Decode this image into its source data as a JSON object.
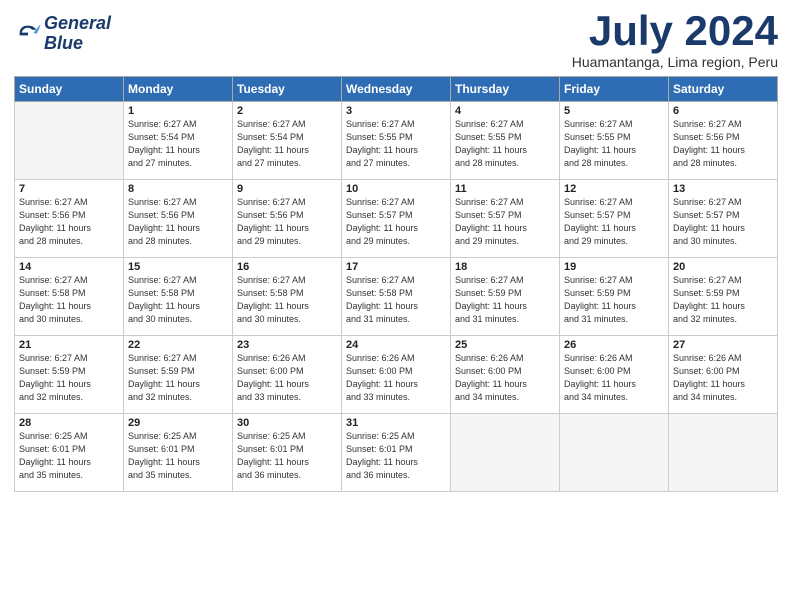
{
  "logo": {
    "line1": "General",
    "line2": "Blue"
  },
  "title": "July 2024",
  "subtitle": "Huamantanga, Lima region, Peru",
  "days_of_week": [
    "Sunday",
    "Monday",
    "Tuesday",
    "Wednesday",
    "Thursday",
    "Friday",
    "Saturday"
  ],
  "weeks": [
    [
      {
        "day": "",
        "details": ""
      },
      {
        "day": "1",
        "details": "Sunrise: 6:27 AM\nSunset: 5:54 PM\nDaylight: 11 hours\nand 27 minutes."
      },
      {
        "day": "2",
        "details": "Sunrise: 6:27 AM\nSunset: 5:54 PM\nDaylight: 11 hours\nand 27 minutes."
      },
      {
        "day": "3",
        "details": "Sunrise: 6:27 AM\nSunset: 5:55 PM\nDaylight: 11 hours\nand 27 minutes."
      },
      {
        "day": "4",
        "details": "Sunrise: 6:27 AM\nSunset: 5:55 PM\nDaylight: 11 hours\nand 28 minutes."
      },
      {
        "day": "5",
        "details": "Sunrise: 6:27 AM\nSunset: 5:55 PM\nDaylight: 11 hours\nand 28 minutes."
      },
      {
        "day": "6",
        "details": "Sunrise: 6:27 AM\nSunset: 5:56 PM\nDaylight: 11 hours\nand 28 minutes."
      }
    ],
    [
      {
        "day": "7",
        "details": "Sunrise: 6:27 AM\nSunset: 5:56 PM\nDaylight: 11 hours\nand 28 minutes."
      },
      {
        "day": "8",
        "details": "Sunrise: 6:27 AM\nSunset: 5:56 PM\nDaylight: 11 hours\nand 28 minutes."
      },
      {
        "day": "9",
        "details": "Sunrise: 6:27 AM\nSunset: 5:56 PM\nDaylight: 11 hours\nand 29 minutes."
      },
      {
        "day": "10",
        "details": "Sunrise: 6:27 AM\nSunset: 5:57 PM\nDaylight: 11 hours\nand 29 minutes."
      },
      {
        "day": "11",
        "details": "Sunrise: 6:27 AM\nSunset: 5:57 PM\nDaylight: 11 hours\nand 29 minutes."
      },
      {
        "day": "12",
        "details": "Sunrise: 6:27 AM\nSunset: 5:57 PM\nDaylight: 11 hours\nand 29 minutes."
      },
      {
        "day": "13",
        "details": "Sunrise: 6:27 AM\nSunset: 5:57 PM\nDaylight: 11 hours\nand 30 minutes."
      }
    ],
    [
      {
        "day": "14",
        "details": "Sunrise: 6:27 AM\nSunset: 5:58 PM\nDaylight: 11 hours\nand 30 minutes."
      },
      {
        "day": "15",
        "details": "Sunrise: 6:27 AM\nSunset: 5:58 PM\nDaylight: 11 hours\nand 30 minutes."
      },
      {
        "day": "16",
        "details": "Sunrise: 6:27 AM\nSunset: 5:58 PM\nDaylight: 11 hours\nand 30 minutes."
      },
      {
        "day": "17",
        "details": "Sunrise: 6:27 AM\nSunset: 5:58 PM\nDaylight: 11 hours\nand 31 minutes."
      },
      {
        "day": "18",
        "details": "Sunrise: 6:27 AM\nSunset: 5:59 PM\nDaylight: 11 hours\nand 31 minutes."
      },
      {
        "day": "19",
        "details": "Sunrise: 6:27 AM\nSunset: 5:59 PM\nDaylight: 11 hours\nand 31 minutes."
      },
      {
        "day": "20",
        "details": "Sunrise: 6:27 AM\nSunset: 5:59 PM\nDaylight: 11 hours\nand 32 minutes."
      }
    ],
    [
      {
        "day": "21",
        "details": "Sunrise: 6:27 AM\nSunset: 5:59 PM\nDaylight: 11 hours\nand 32 minutes."
      },
      {
        "day": "22",
        "details": "Sunrise: 6:27 AM\nSunset: 5:59 PM\nDaylight: 11 hours\nand 32 minutes."
      },
      {
        "day": "23",
        "details": "Sunrise: 6:26 AM\nSunset: 6:00 PM\nDaylight: 11 hours\nand 33 minutes."
      },
      {
        "day": "24",
        "details": "Sunrise: 6:26 AM\nSunset: 6:00 PM\nDaylight: 11 hours\nand 33 minutes."
      },
      {
        "day": "25",
        "details": "Sunrise: 6:26 AM\nSunset: 6:00 PM\nDaylight: 11 hours\nand 34 minutes."
      },
      {
        "day": "26",
        "details": "Sunrise: 6:26 AM\nSunset: 6:00 PM\nDaylight: 11 hours\nand 34 minutes."
      },
      {
        "day": "27",
        "details": "Sunrise: 6:26 AM\nSunset: 6:00 PM\nDaylight: 11 hours\nand 34 minutes."
      }
    ],
    [
      {
        "day": "28",
        "details": "Sunrise: 6:25 AM\nSunset: 6:01 PM\nDaylight: 11 hours\nand 35 minutes."
      },
      {
        "day": "29",
        "details": "Sunrise: 6:25 AM\nSunset: 6:01 PM\nDaylight: 11 hours\nand 35 minutes."
      },
      {
        "day": "30",
        "details": "Sunrise: 6:25 AM\nSunset: 6:01 PM\nDaylight: 11 hours\nand 36 minutes."
      },
      {
        "day": "31",
        "details": "Sunrise: 6:25 AM\nSunset: 6:01 PM\nDaylight: 11 hours\nand 36 minutes."
      },
      {
        "day": "",
        "details": ""
      },
      {
        "day": "",
        "details": ""
      },
      {
        "day": "",
        "details": ""
      }
    ]
  ]
}
